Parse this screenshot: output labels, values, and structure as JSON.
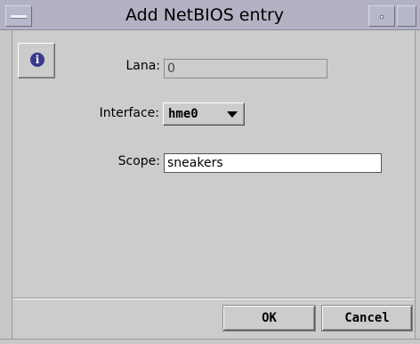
{
  "window": {
    "title": "Add NetBIOS entry"
  },
  "form": {
    "lana": {
      "label": "Lana:",
      "value": "0"
    },
    "interface": {
      "label": "Interface:",
      "selected": "hme0"
    },
    "scope": {
      "label": "Scope:",
      "value": "sneakers"
    }
  },
  "buttons": {
    "ok": "OK",
    "cancel": "Cancel"
  },
  "icons": {
    "info": "i"
  }
}
